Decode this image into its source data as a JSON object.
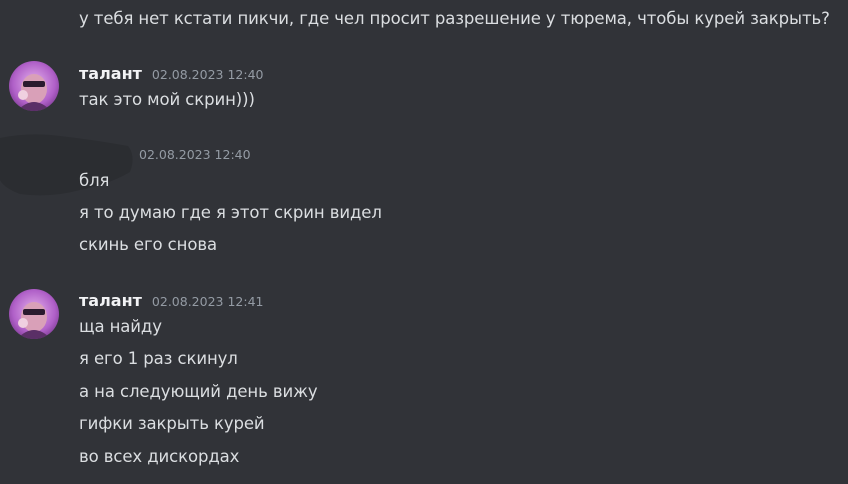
{
  "messages": {
    "continuation": {
      "text": "у тебя нет кстати пикчи, где чел просит разрешение у тюрема, чтобы курей закрыть?"
    },
    "group1": {
      "username": "талант",
      "timestamp": "02.08.2023 12:40",
      "lines": [
        "так это мой скрин)))"
      ]
    },
    "group2": {
      "timestamp": "02.08.2023 12:40",
      "lines": [
        "бля",
        "я то думаю где я этот скрин видел",
        "скинь его снова"
      ]
    },
    "group3": {
      "username": "талант",
      "timestamp": "02.08.2023 12:41",
      "lines": [
        "ща найду",
        "я его 1 раз скинул",
        "а на следующий день вижу",
        "гифки закрыть курей",
        "во всех дискордах"
      ]
    }
  },
  "colors": {
    "background": "#313338",
    "text": "#dbdee1",
    "username": "#f2f3f5",
    "timestamp": "#949ba4",
    "avatar_accent": "#b060c8"
  }
}
